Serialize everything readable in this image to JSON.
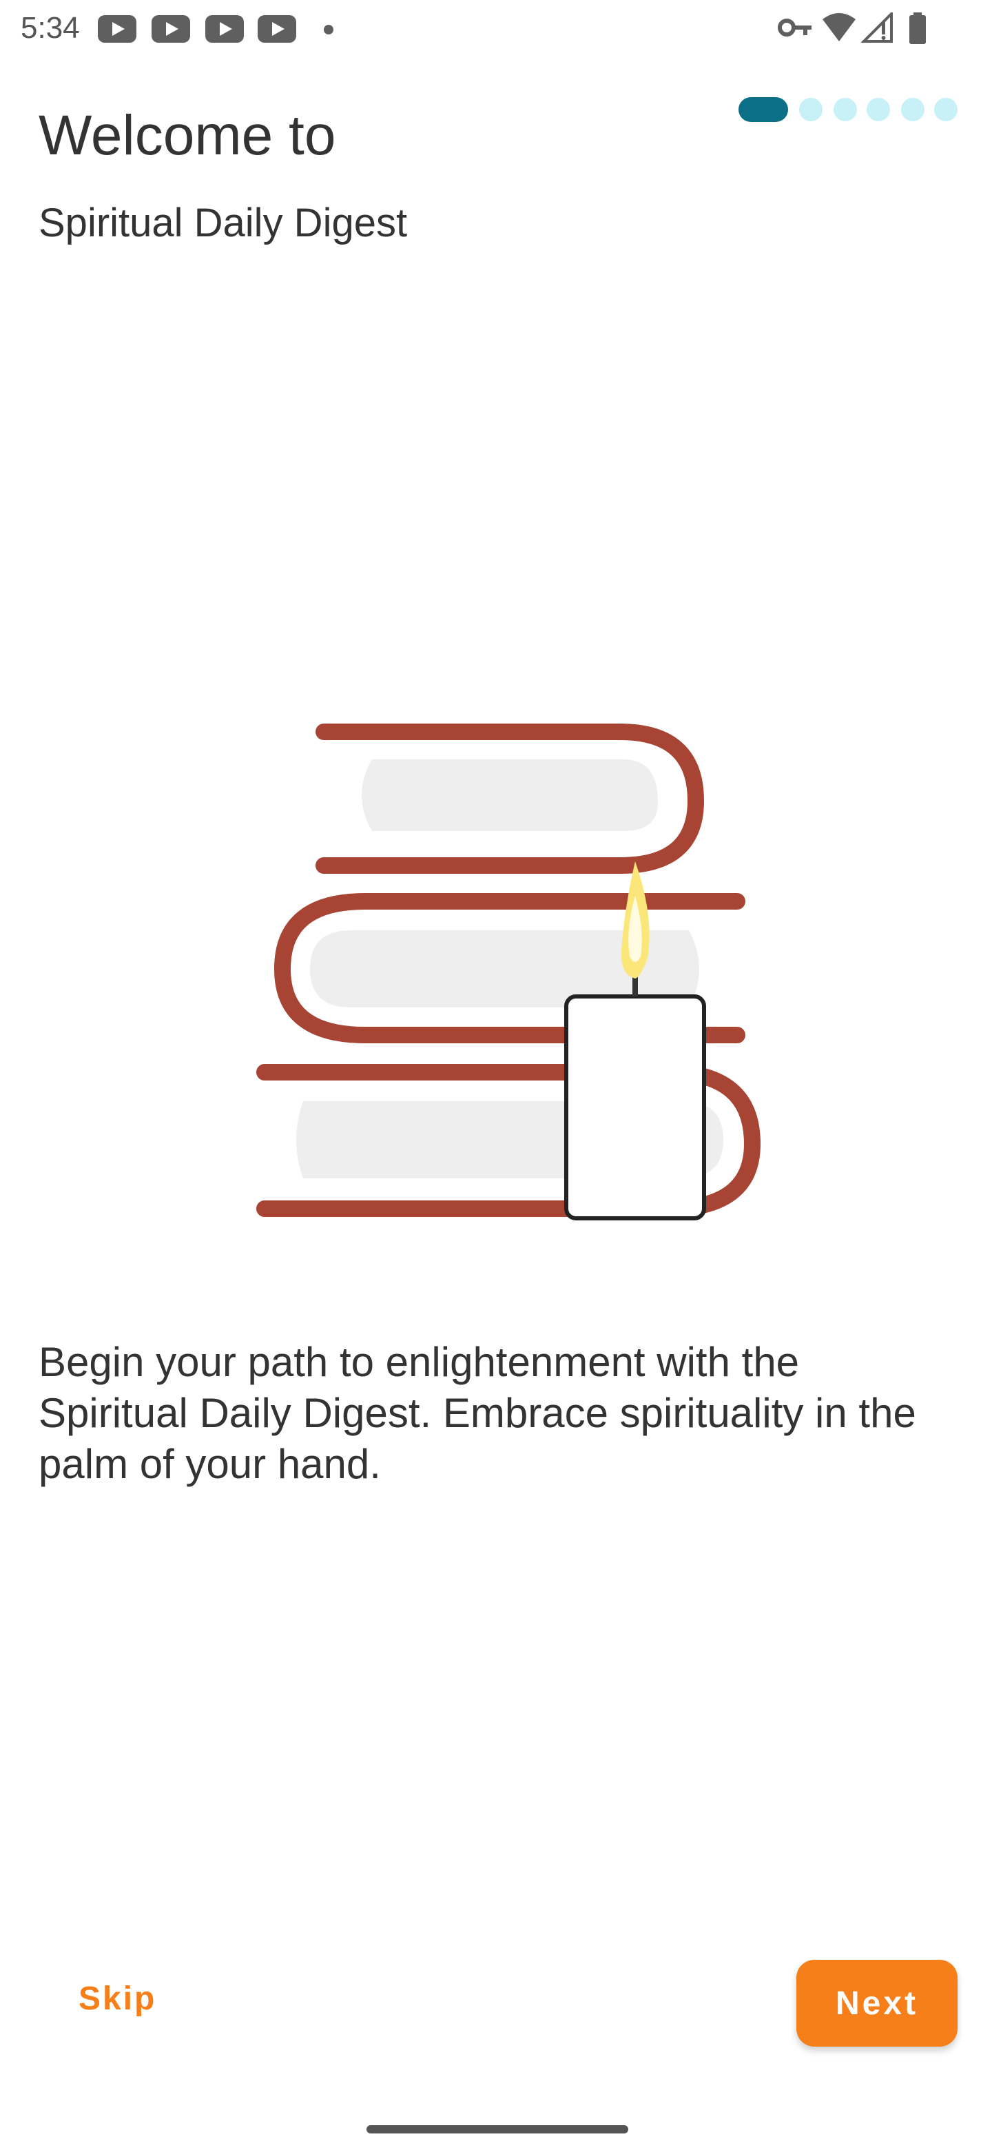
{
  "status_bar": {
    "time": "5:34",
    "notification_icons": [
      "youtube-icon",
      "youtube-icon",
      "youtube-icon",
      "youtube-icon"
    ],
    "right_icons": [
      "vpn-key-icon",
      "wifi-icon",
      "cell-signal-icon",
      "battery-icon"
    ]
  },
  "header": {
    "title": "Welcome to",
    "subtitle": "Spiritual Daily Digest"
  },
  "pager": {
    "total_pages": 6,
    "current_page": 1
  },
  "illustration": {
    "name": "books-and-candle-illustration"
  },
  "description": "Begin your path to enlightenment with the Spiritual Daily Digest. Embrace spirituality in the palm of your hand.",
  "buttons": {
    "skip_label": "Skip",
    "next_label": "Next"
  },
  "colors": {
    "accent": "#f77f1a",
    "pager_active": "#0b6f88",
    "pager_inactive": "#c7f1f6",
    "book_spine": "#a84433",
    "book_pages": "#eeeeee"
  }
}
